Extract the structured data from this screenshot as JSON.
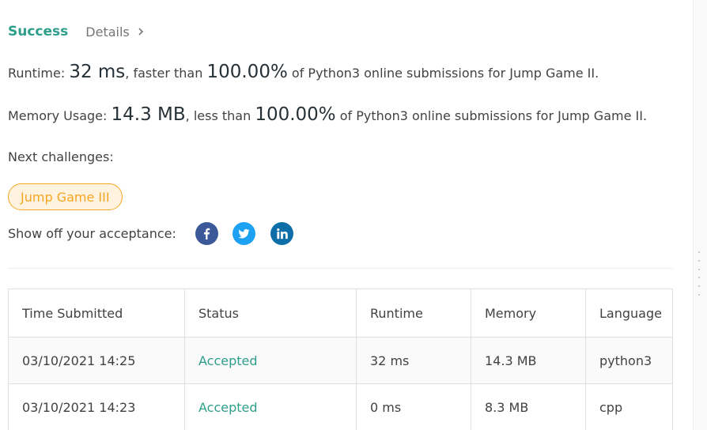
{
  "header": {
    "status": "Success",
    "details_label": "Details"
  },
  "runtime": {
    "label": "Runtime:",
    "value": "32 ms",
    "comparison": ", faster than",
    "percent": "100.00%",
    "suffix": "of Python3 online submissions for Jump Game II."
  },
  "memory": {
    "label": "Memory Usage:",
    "value": "14.3 MB",
    "comparison": ", less than",
    "percent": "100.00%",
    "suffix": "of Python3 online submissions for Jump Game II."
  },
  "next": {
    "label": "Next challenges:",
    "challenges": [
      "Jump Game III"
    ]
  },
  "share": {
    "label": "Show off your acceptance:",
    "icons": [
      "facebook-icon",
      "twitter-icon",
      "linkedin-icon"
    ]
  },
  "table": {
    "headers": [
      "Time Submitted",
      "Status",
      "Runtime",
      "Memory",
      "Language"
    ],
    "rows": [
      [
        "03/10/2021 14:25",
        "Accepted",
        "32 ms",
        "14.3 MB",
        "python3"
      ],
      [
        "03/10/2021 14:23",
        "Accepted",
        "0 ms",
        "8.3 MB",
        "cpp"
      ]
    ]
  },
  "colors": {
    "accent": "#2e9e8b",
    "challenge": "#f5a623",
    "facebook": "#3b5998",
    "twitter": "#1da1f2",
    "linkedin": "#0e6ea8"
  }
}
